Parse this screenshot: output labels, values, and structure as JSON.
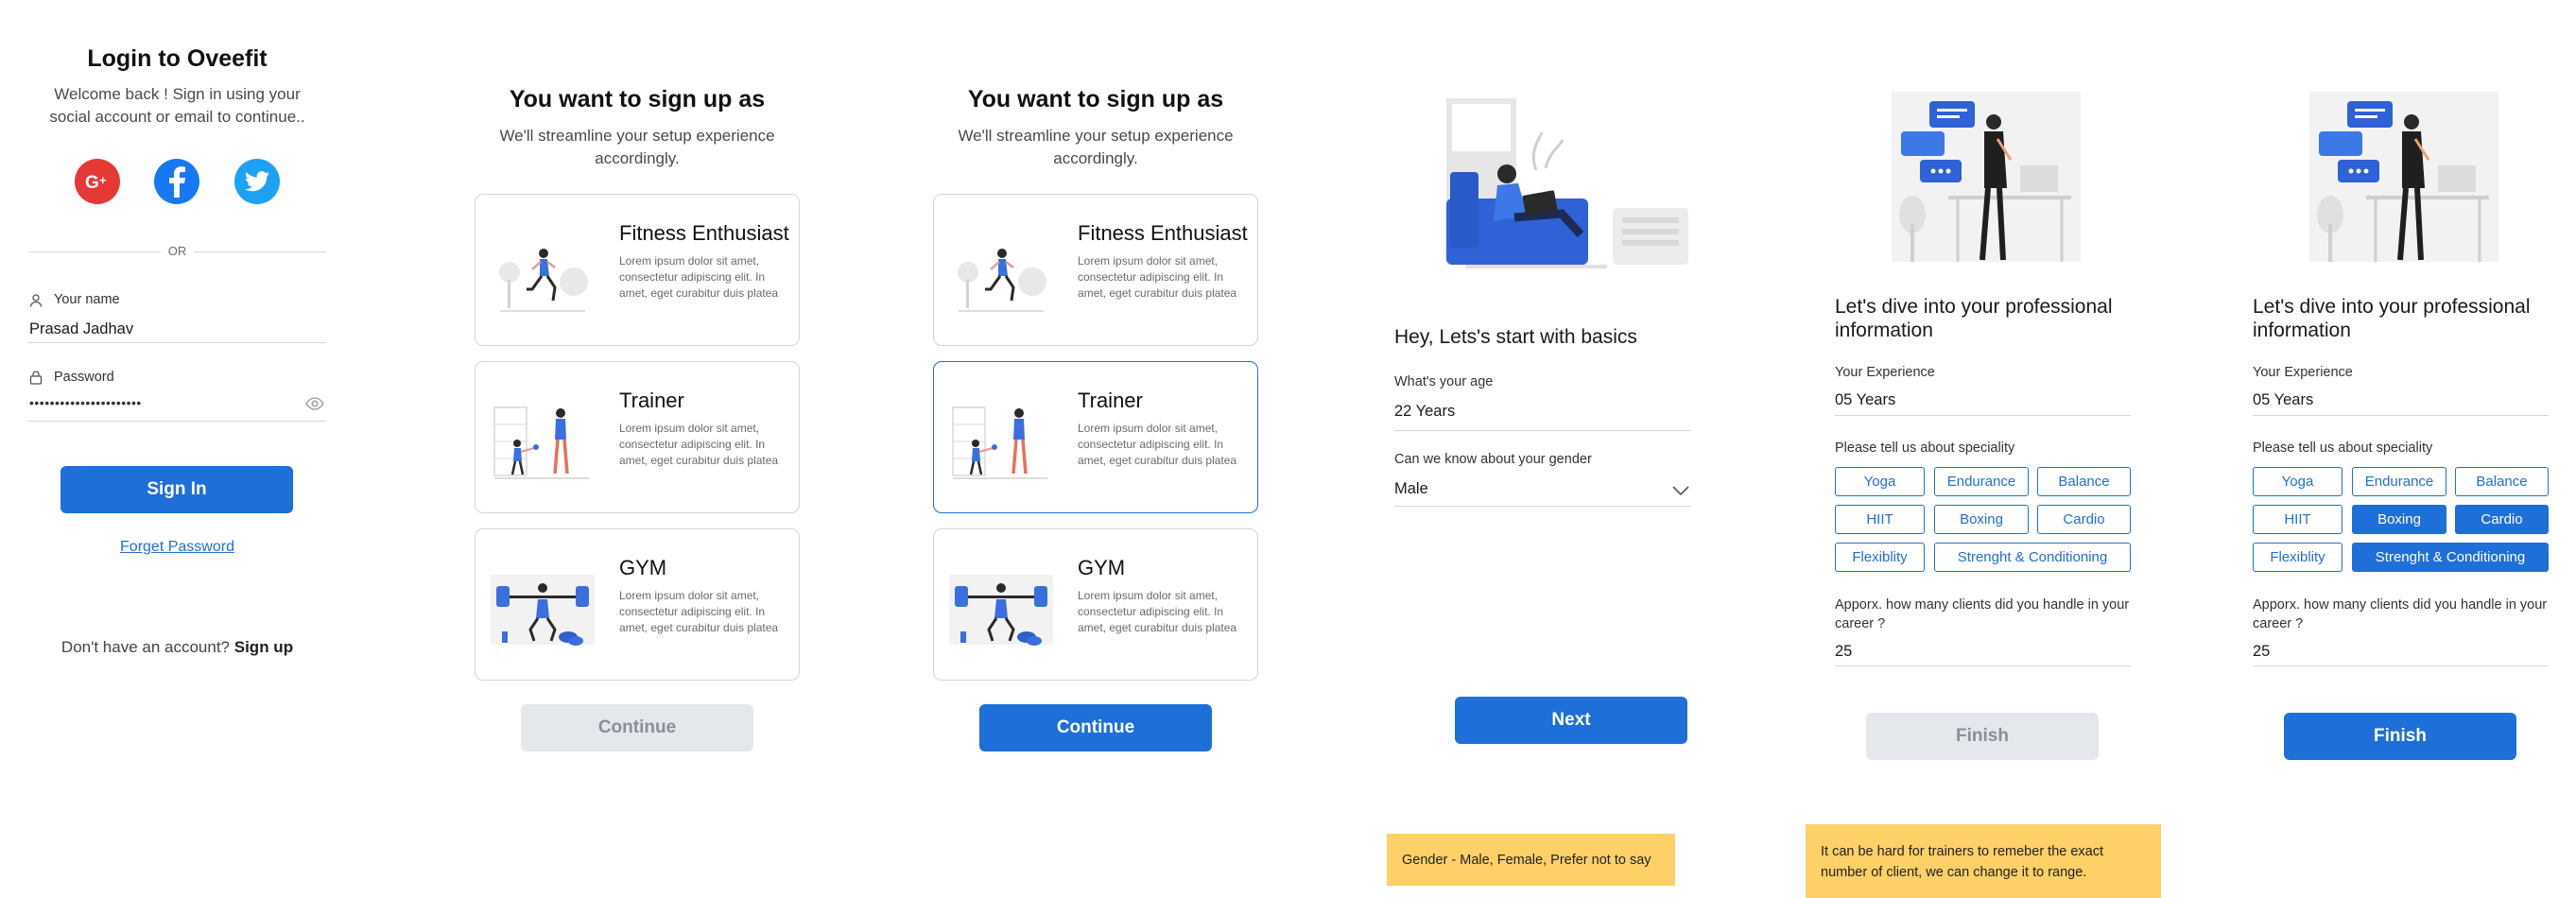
{
  "login": {
    "title": "Login to Oveefit",
    "subtitle_line1": "Welcome back ! Sign in using your",
    "subtitle_line2": "social account or email to continue..",
    "social": [
      "google-plus",
      "facebook",
      "twitter"
    ],
    "or_label": "OR",
    "name_label": "Your name",
    "name_value": "Prasad Jadhav",
    "password_label": "Password",
    "password_value": "••••••••••••••••••••••",
    "signin_label": "Sign In",
    "forgot_label": "Forget Password",
    "no_account_text": "Don't have an account? ",
    "signup_label": "Sign up"
  },
  "role_select": {
    "title": "You want to sign up as",
    "subtitle_line1": "We'll streamline your setup experience",
    "subtitle_line2": "accordingly.",
    "cards": [
      {
        "title": "Fitness Enthusiast",
        "desc": "Lorem ipsum dolor sit amet, consectetur adipiscing elit. In amet, eget curabitur duis platea"
      },
      {
        "title": "Trainer",
        "desc": "Lorem ipsum dolor sit amet, consectetur adipiscing elit. In amet, eget curabitur duis platea"
      },
      {
        "title": "GYM",
        "desc": "Lorem ipsum dolor sit amet, consectetur adipiscing elit. In amet, eget curabitur duis platea"
      }
    ],
    "continue_label": "Continue",
    "selected_card_screen3": "Trainer"
  },
  "basics": {
    "heading": "Hey, Lets's start with basics",
    "age_label": "What's your age",
    "age_value": "22 Years",
    "gender_label": "Can we know about your gender",
    "gender_value": "Male",
    "next_label": "Next",
    "note": "Gender - Male, Female, Prefer not to say"
  },
  "professional": {
    "heading_line1": "Let's dive into your professional",
    "heading_line2": "information",
    "experience_label": "Your Experience",
    "experience_value": "05 Years",
    "speciality_label": "Please tell us about speciality",
    "chips": [
      "Yoga",
      "Endurance",
      "Balance",
      "HIIT",
      "Boxing",
      "Cardio",
      "Flexiblity",
      "Strenght & Conditioning"
    ],
    "selected_chips_screen6": [
      "Boxing",
      "Cardio",
      "Strenght & Conditioning"
    ],
    "clients_label_line1": "Apporx. how many clients did you handle in your",
    "clients_label_line2": "career ?",
    "clients_value": "25",
    "finish_label": "Finish",
    "note_line1": "It can be hard for trainers to remeber the exact",
    "note_line2": "number of client, we can change it to range."
  },
  "colors": {
    "primary": "#1f6fd9",
    "disabled": "#e4e7ec",
    "note": "#fdd068",
    "google": "#e53935",
    "facebook": "#1877f2",
    "twitter": "#1da1f2"
  }
}
